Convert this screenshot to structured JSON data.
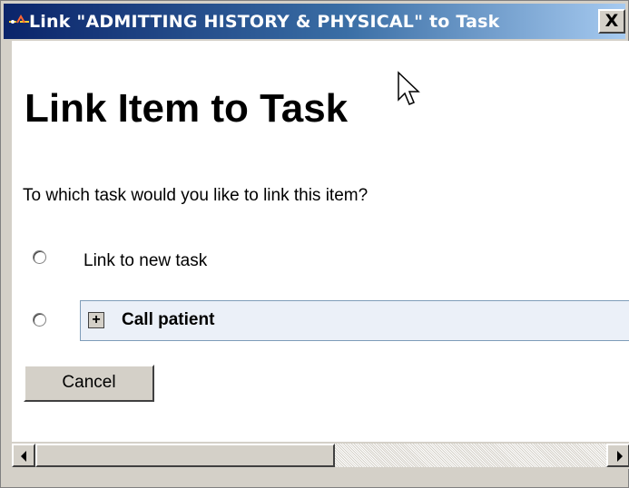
{
  "window": {
    "title": "Link \"ADMITTING HISTORY & PHYSICAL\" to Task",
    "close_label": "X"
  },
  "main": {
    "heading": "Link Item to Task",
    "question": "To which task would you like to link this item?",
    "options": [
      {
        "label": "Link to new task",
        "selected": false
      },
      {
        "label": "Call patient",
        "selected": false,
        "expand_label": "+"
      }
    ],
    "cancel_label": "Cancel"
  },
  "scrollbar": {
    "position": 0.0
  },
  "colors": {
    "titlebar_start": "#0a246a",
    "titlebar_end": "#a6caf0",
    "task_row_bg": "#ebf0f8",
    "chrome": "#d4d0c8"
  },
  "icons": {
    "title": "app-icon",
    "close": "close-icon",
    "expand": "plus-icon",
    "scroll_left": "arrow-left-icon",
    "scroll_right": "arrow-right-icon",
    "cursor": "mouse-pointer-icon"
  }
}
